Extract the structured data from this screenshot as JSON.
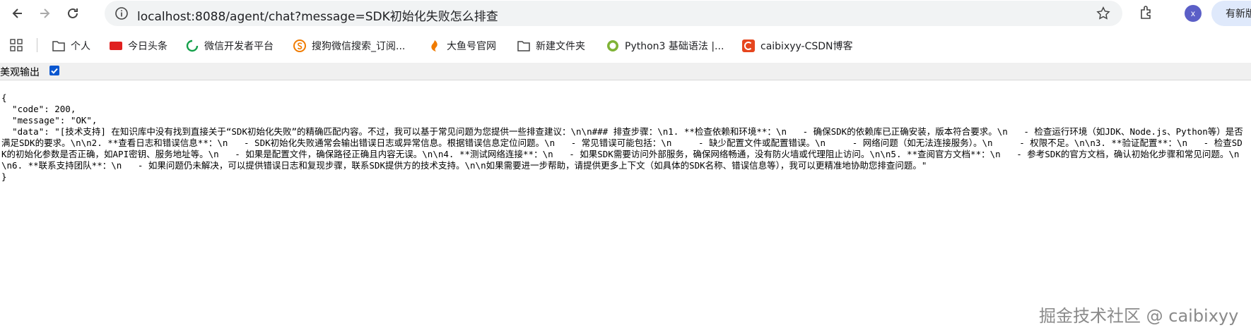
{
  "browser": {
    "url": "localhost:8088/agent/chat?message=SDK初始化失败怎么排查",
    "avatar_letter": "x",
    "new_button_label": "有新版"
  },
  "bookmarks": [
    {
      "label": "个人",
      "icon": "folder-icon"
    },
    {
      "label": "今日头条",
      "icon": "toutiao-icon"
    },
    {
      "label": "微信开发者平台",
      "icon": "wechat-dev-icon"
    },
    {
      "label": "搜狗微信搜索_订阅...",
      "icon": "sogou-icon"
    },
    {
      "label": "大鱼号官网",
      "icon": "dayu-icon"
    },
    {
      "label": "新建文件夹",
      "icon": "folder-icon"
    },
    {
      "label": "Python3 基础语法 |...",
      "icon": "runoob-icon"
    },
    {
      "label": "caibixyy-CSDN博客",
      "icon": "csdn-icon"
    }
  ],
  "pagebar": {
    "label": "美观输出",
    "checked": true
  },
  "json_view": {
    "open_brace": "{",
    "code_line": "  \"code\": 200,",
    "message_line": "  \"message\": \"OK\",",
    "data_line": "  \"data\": \"[技术支持] 在知识库中没有找到直接关于“SDK初始化失败”的精确匹配内容。不过，我可以基于常见问题为您提供一些排查建议：\\n\\n### 排查步骤：\\n1. **检查依赖和环境**：\\n   - 确保SDK的依赖库已正确安装，版本符合要求。\\n   - 检查运行环境（如JDK、Node.js、Python等）是否满足SDK的要求。\\n\\n2. **查看日志和错误信息**：\\n   - SDK初始化失败通常会输出错误日志或异常信息。根据错误信息定位问题。\\n   - 常见错误可能包括：\\n     - 缺少配置文件或配置错误。\\n     - 网络问题（如无法连接服务）。\\n     - 权限不足。\\n\\n3. **验证配置**：\\n   - 检查SDK的初始化参数是否正确，如API密钥、服务地址等。\\n   - 如果是配置文件，确保路径正确且内容无误。\\n\\n4. **测试网络连接**：\\n   - 如果SDK需要访问外部服务，确保网络畅通，没有防火墙或代理阻止访问。\\n\\n5. **查阅官方文档**：\\n   - 参考SDK的官方文档，确认初始化步骤和常见问题。\\n\\n6. **联系支持团队**：\\n   - 如果问题仍未解决，可以提供错误日志和复现步骤，联系SDK提供方的技术支持。\\n\\n如果需要进一步帮助，请提供更多上下文（如具体的SDK名称、错误信息等），我可以更精准地协助您排查问题。\"",
    "close_brace": "}"
  },
  "watermark": "掘金技术社区 @ caibixyy"
}
